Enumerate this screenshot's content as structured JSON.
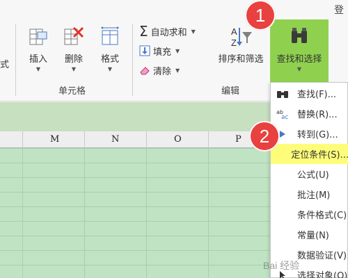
{
  "titlebar": {
    "login": "登"
  },
  "ribbon": {
    "partial_label": "式",
    "cells_group": {
      "label": "单元格",
      "insert": "插入",
      "delete": "删除",
      "format": "格式"
    },
    "edit_group": {
      "label": "编辑",
      "autosum": "自动求和",
      "fill": "填充",
      "clear": "清除",
      "sort_filter": "排序和筛选",
      "find_select": "查找和选择"
    }
  },
  "columns": [
    "M",
    "N",
    "O",
    "P"
  ],
  "menu": {
    "items": [
      {
        "label": "查找(F)...",
        "icon": "binoculars-icon"
      },
      {
        "label": "替换(R)...",
        "icon": "replace-icon"
      },
      {
        "label": "转到(G)...",
        "icon": "goto-arrow-icon"
      },
      {
        "label": "定位条件(S)...",
        "icon": "",
        "highlighted": true
      },
      {
        "label": "公式(U)",
        "icon": ""
      },
      {
        "label": "批注(M)",
        "icon": ""
      },
      {
        "label": "条件格式(C)",
        "icon": ""
      },
      {
        "label": "常量(N)",
        "icon": ""
      },
      {
        "label": "数据验证(V)",
        "icon": ""
      },
      {
        "label": "选择对象(O)",
        "icon": "select-arrow-icon"
      }
    ]
  },
  "markers": [
    "1",
    "2"
  ],
  "watermark": "Bai 经验",
  "colors": {
    "find_button_bg": "#8fd14f",
    "marker": "#e8413f",
    "highlight": "#fdfd7a",
    "sheet": "#bfe3c3"
  }
}
